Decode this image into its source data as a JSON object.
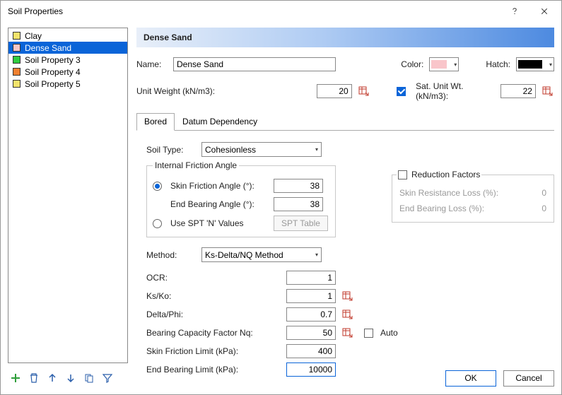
{
  "window": {
    "title": "Soil Properties"
  },
  "sidebar": {
    "items": [
      {
        "label": "Clay",
        "color": "#f2e36b"
      },
      {
        "label": "Dense Sand",
        "color": "#f6c6c6",
        "selected": true
      },
      {
        "label": "Soil Property 3",
        "color": "#2ecc40"
      },
      {
        "label": "Soil Property 4",
        "color": "#f08030"
      },
      {
        "label": "Soil Property 5",
        "color": "#f2e36b"
      }
    ]
  },
  "header": {
    "title": "Dense Sand"
  },
  "basic": {
    "name_label": "Name:",
    "name_value": "Dense Sand",
    "color_label": "Color:",
    "color_value": "#f9c5ca",
    "hatch_label": "Hatch:",
    "hatch_value": "#000000",
    "unit_weight_label": "Unit Weight (kN/m3):",
    "unit_weight_value": "20",
    "sat_unit_weight_label": "Sat. Unit Wt. (kN/m3):",
    "sat_unit_weight_value": "22",
    "sat_checked": true
  },
  "tabs": {
    "items": [
      {
        "label": "Bored",
        "active": true
      },
      {
        "label": "Datum Dependency",
        "active": false
      }
    ]
  },
  "bored": {
    "soil_type_label": "Soil Type:",
    "soil_type_value": "Cohesionless",
    "internal_friction_legend": "Internal Friction Angle",
    "radio_skin_label": "Skin Friction Angle (°):",
    "radio_skin_checked": true,
    "skin_value": "38",
    "end_bearing_label": "End Bearing Angle (°):",
    "end_bearing_value": "38",
    "radio_spt_label": "Use SPT 'N' Values",
    "radio_spt_checked": false,
    "spt_table_label": "SPT Table",
    "method_label": "Method:",
    "method_value": "Ks-Delta/NQ Method",
    "ocr_label": "OCR:",
    "ocr_value": "1",
    "ksko_label": "Ks/Ko:",
    "ksko_value": "1",
    "deltaphi_label": "Delta/Phi:",
    "deltaphi_value": "0.7",
    "nq_label": "Bearing Capacity Factor Nq:",
    "nq_value": "50",
    "auto_label": "Auto",
    "skin_limit_label": "Skin Friction Limit (kPa):",
    "skin_limit_value": "400",
    "end_limit_label": "End Bearing Limit (kPa):",
    "end_limit_value": "10000"
  },
  "reduction": {
    "legend": "Reduction Factors",
    "enabled": false,
    "skin_loss_label": "Skin Resistance Loss (%):",
    "skin_loss_value": "0",
    "end_loss_label": "End Bearing Loss (%):",
    "end_loss_value": "0"
  },
  "footer": {
    "ok": "OK",
    "cancel": "Cancel"
  }
}
